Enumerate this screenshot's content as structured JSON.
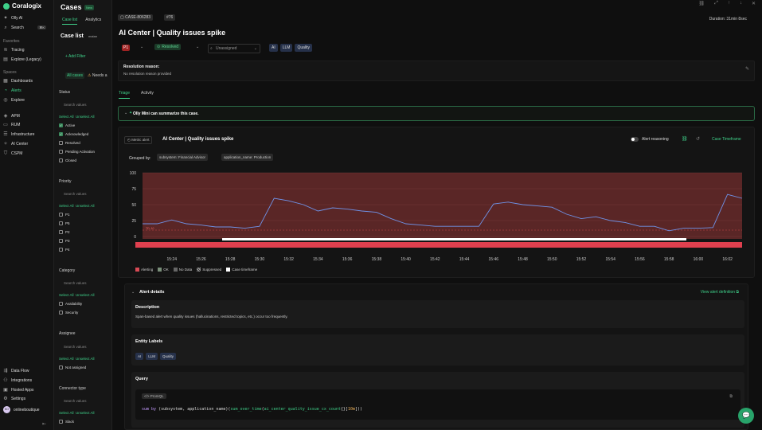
{
  "nav": {
    "brand": "Coralogix",
    "top": [
      {
        "label": "Olly AI",
        "icon": "sparkle-icon"
      },
      {
        "label": "Search",
        "icon": "search-icon",
        "kbd": "⌘K"
      }
    ],
    "favorites_label": "Favorites",
    "favorites": [
      {
        "label": "Tracing",
        "icon": "tracing-icon"
      },
      {
        "label": "Explore (Legacy)",
        "icon": "explore-icon"
      }
    ],
    "spaces_label": "Spaces",
    "spaces": [
      {
        "label": "Dashboards",
        "icon": "dashboard-icon"
      },
      {
        "label": "Alerts",
        "icon": "bell-icon",
        "active": true
      },
      {
        "label": "Explore",
        "icon": "compass-icon"
      }
    ],
    "modules": [
      {
        "label": "APM",
        "icon": "apm-icon"
      },
      {
        "label": "RUM",
        "icon": "rum-icon"
      },
      {
        "label": "Infrastructure",
        "icon": "server-icon"
      },
      {
        "label": "AI Center",
        "icon": "ai-icon"
      },
      {
        "label": "CSPM",
        "icon": "shield-icon"
      }
    ],
    "bottom": [
      {
        "label": "Data Flow",
        "icon": "flow-icon"
      },
      {
        "label": "Integrations",
        "icon": "plug-icon"
      },
      {
        "label": "Hosted Apps",
        "icon": "apps-icon"
      },
      {
        "label": "Settings",
        "icon": "gear-icon"
      }
    ],
    "user": {
      "initials": "BO",
      "name": "onlineboutique"
    }
  },
  "panel": {
    "title": "Cases",
    "new_badge": "New",
    "tabs": [
      "Case list",
      "Analytics"
    ],
    "case_list_label": "Case list",
    "case_list_sub": "matan",
    "add_filter": "Add Filter",
    "chip_all": "All cases",
    "chip_needs": "Needs a",
    "search_placeholder": "Search values",
    "select_all": "Select All",
    "unselect_all": "Unselect All",
    "status": {
      "label": "Status",
      "options": [
        {
          "label": "Active",
          "checked": true
        },
        {
          "label": "Acknowledged",
          "checked": true
        },
        {
          "label": "Resolved",
          "checked": false
        },
        {
          "label": "Pending Activation",
          "checked": false
        },
        {
          "label": "Closed",
          "checked": false
        }
      ]
    },
    "priority": {
      "label": "Priority",
      "options": [
        {
          "label": "P1"
        },
        {
          "label": "P5"
        },
        {
          "label": "P2"
        },
        {
          "label": "P3"
        },
        {
          "label": "P4"
        }
      ]
    },
    "category": {
      "label": "Category",
      "options": [
        {
          "label": "Availability"
        },
        {
          "label": "Security"
        }
      ]
    },
    "assignee": {
      "label": "Assignee",
      "options": [
        {
          "label": "Not assigned"
        }
      ]
    },
    "connector": {
      "label": "Connector type",
      "options": [
        {
          "label": "Slack"
        }
      ]
    }
  },
  "main": {
    "case_id": "CASE-806283",
    "case_num": "76",
    "duration": "Duration: 31min 8sec",
    "title": "AI Center | Quality issues spike",
    "priority": "P1",
    "status": "Resolved",
    "assignee": "Unassigned",
    "tags": [
      "AI",
      "LLM",
      "Quality"
    ],
    "resolution_label": "Resolution reason:",
    "resolution_value": "No resolution reason provided",
    "tabs": [
      "Triage",
      "Activity"
    ],
    "olly": "Olly Mini can summarize this case.",
    "alert": {
      "type_pill": "Metric alert",
      "title": "AI Center | Quality issues spike",
      "reasoning": "Alert reasoning",
      "case_timeframe": "Case Timeframe",
      "grouped_by": "Grouped by:",
      "groups": [
        "subsystem: Financial Advisor",
        "application_name: Production"
      ]
    },
    "legend": [
      "Alerting",
      "OK",
      "No Data",
      "Suppressed",
      "Case timeframe"
    ],
    "details": {
      "title": "Alert details",
      "view_def": "View alert definition",
      "description_label": "Description",
      "description": "Span-based alert when quality issues (hallucinations, restricted topics, etc.) occur too frequently.",
      "entity_label": "Entity Labels",
      "entity": [
        "AI",
        "LLM",
        "Quality"
      ],
      "query_label": "Query",
      "promql": "PromQL"
    }
  },
  "chart_data": {
    "type": "line",
    "x": [
      "15:22",
      "15:23",
      "15:24",
      "15:25",
      "15:26",
      "15:27",
      "15:28",
      "15:29",
      "15:30",
      "15:31",
      "15:32",
      "15:33",
      "15:34",
      "15:35",
      "15:36",
      "15:37",
      "15:38",
      "15:39",
      "15:40",
      "15:41",
      "15:42",
      "15:43",
      "15:44",
      "15:45",
      "15:46",
      "15:47",
      "15:48",
      "15:49",
      "15:50",
      "15:51",
      "15:52",
      "15:53",
      "15:54",
      "15:55",
      "15:56",
      "15:57",
      "15:58",
      "15:59",
      "16:00",
      "16:01",
      "16:02",
      "16:03"
    ],
    "values": [
      20,
      20,
      26,
      20,
      18,
      15,
      15,
      13,
      16,
      60,
      56,
      50,
      40,
      45,
      43,
      40,
      38,
      28,
      20,
      18,
      16,
      16,
      16,
      16,
      51,
      54,
      50,
      48,
      46,
      35,
      28,
      31,
      25,
      22,
      16,
      16,
      9,
      13,
      13,
      14,
      66,
      60
    ],
    "tick_labels_x": [
      "15:24",
      "15:26",
      "15:28",
      "15:30",
      "15:32",
      "15:34",
      "15:36",
      "15:38",
      "15:40",
      "15:42",
      "15:44",
      "15:46",
      "15:48",
      "15:50",
      "15:52",
      "15:54",
      "15:56",
      "15:58",
      "16:00",
      "16:02"
    ],
    "tick_labels_y": [
      "100",
      "75",
      "50",
      "25",
      "0"
    ],
    "ylim": [
      0,
      100
    ],
    "threshold_label": "TD: 10"
  }
}
